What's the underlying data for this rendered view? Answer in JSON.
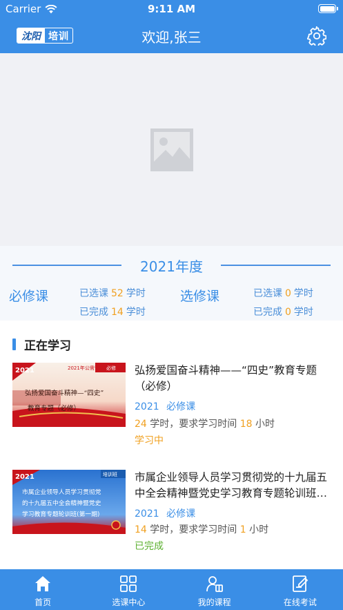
{
  "status_bar": {
    "carrier": "Carrier",
    "time": "9:11 AM"
  },
  "header": {
    "logo_left": "沈阳",
    "logo_right": "培训",
    "title": "欢迎,张三",
    "settings_icon": "gear-icon"
  },
  "banner": {
    "icon": "image-placeholder-icon"
  },
  "year_panel": {
    "title": "2021年度",
    "required": {
      "label": "必修课",
      "selected_label": "已选课",
      "selected_value": "52",
      "selected_unit": "学时",
      "completed_label": "已完成",
      "completed_value": "14",
      "completed_unit": "学时"
    },
    "elective": {
      "label": "选修课",
      "selected_label": "已选课",
      "selected_value": "0",
      "selected_unit": "学时",
      "completed_label": "已完成",
      "completed_value": "0",
      "completed_unit": "学时"
    }
  },
  "learning": {
    "section_title": "正在学习",
    "courses": [
      {
        "title": "弘扬爱国奋斗精神——“四史”教育专题（必修）",
        "year": "2021",
        "type": "必修课",
        "hours": "24",
        "hours_unit": "学时，要求学习时间",
        "required_time": "18",
        "time_unit": "小时",
        "status": "学习中",
        "status_color": "#f0a020",
        "thumb": {
          "year": "2021",
          "tag": "2021年公需课",
          "badge": "必修",
          "line1": "弘扬爱国奋斗精神—“四史”",
          "line2": "教育专题（必修）"
        }
      },
      {
        "title": "市属企业领导人员学习贯彻党的十九届五中全会精神暨党史学习教育专题轮训班（第一期）",
        "year": "2021",
        "type": "必修课",
        "hours": "14",
        "hours_unit": "学时，要求学习时间",
        "required_time": "1",
        "time_unit": "小时",
        "status": "已完成",
        "status_color": "#5cb030",
        "thumb": {
          "year": "2021",
          "tag": "培训班",
          "line1": "市属企业领导人员学习贯彻党",
          "line2": "的十九届五中全会精神暨党史",
          "line3": "学习教育专题轮训班(第一期)"
        }
      }
    ]
  },
  "tabbar": {
    "items": [
      {
        "label": "首页",
        "icon": "home-icon"
      },
      {
        "label": "选课中心",
        "icon": "grid-icon"
      },
      {
        "label": "我的课程",
        "icon": "user-book-icon"
      },
      {
        "label": "在线考试",
        "icon": "exam-edit-icon"
      }
    ]
  }
}
